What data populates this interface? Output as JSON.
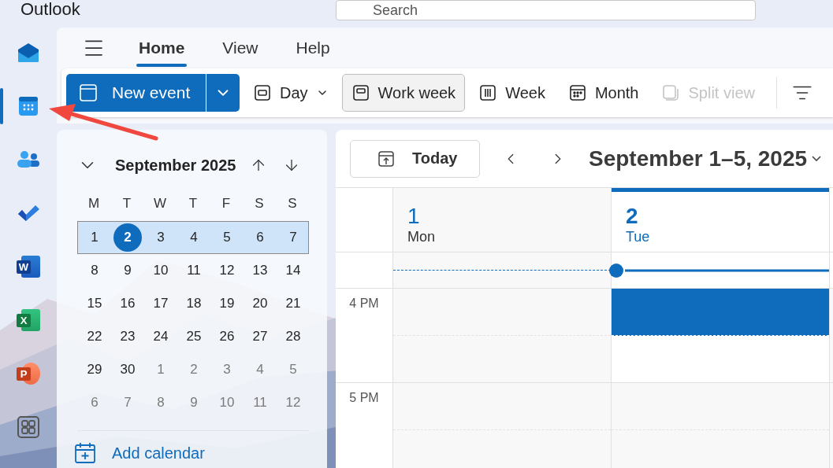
{
  "app_title": "Outlook",
  "search": {
    "placeholder": "Search"
  },
  "rail": [
    {
      "kind": "mail",
      "selected": false
    },
    {
      "kind": "calendar",
      "selected": true
    },
    {
      "kind": "people",
      "selected": false
    },
    {
      "kind": "todo",
      "selected": false
    },
    {
      "kind": "word",
      "letter": "W",
      "selected": false
    },
    {
      "kind": "excel",
      "letter": "X",
      "selected": false
    },
    {
      "kind": "powerpoint",
      "letter": "P",
      "selected": false
    },
    {
      "kind": "apps",
      "selected": false
    }
  ],
  "menu_tabs": [
    {
      "label": "Home",
      "selected": true
    },
    {
      "label": "View",
      "selected": false
    },
    {
      "label": "Help",
      "selected": false
    }
  ],
  "toolbar": {
    "new_event": "New event",
    "views": [
      {
        "kind": "day",
        "label": "Day",
        "selected": false,
        "disabled": false,
        "has_menu": true
      },
      {
        "kind": "workweek",
        "label": "Work week",
        "selected": true,
        "disabled": false,
        "has_menu": false
      },
      {
        "kind": "week",
        "label": "Week",
        "selected": false,
        "disabled": false,
        "has_menu": false
      },
      {
        "kind": "month",
        "label": "Month",
        "selected": false,
        "disabled": false,
        "has_menu": false
      },
      {
        "kind": "split",
        "label": "Split view",
        "selected": false,
        "disabled": true,
        "has_menu": false
      }
    ]
  },
  "mini_calendar": {
    "title": "September 2025",
    "weekdays": [
      "M",
      "T",
      "W",
      "T",
      "F",
      "S",
      "S"
    ],
    "weeks": [
      {
        "selected": true,
        "days": [
          {
            "label": "1",
            "in_month": true,
            "today": false
          },
          {
            "label": "2",
            "in_month": true,
            "today": true
          },
          {
            "label": "3",
            "in_month": true,
            "today": false
          },
          {
            "label": "4",
            "in_month": true,
            "today": false
          },
          {
            "label": "5",
            "in_month": true,
            "today": false
          },
          {
            "label": "6",
            "in_month": true,
            "today": false
          },
          {
            "label": "7",
            "in_month": true,
            "today": false
          }
        ]
      },
      {
        "selected": false,
        "days": [
          {
            "label": "8",
            "in_month": true,
            "today": false
          },
          {
            "label": "9",
            "in_month": true,
            "today": false
          },
          {
            "label": "10",
            "in_month": true,
            "today": false
          },
          {
            "label": "11",
            "in_month": true,
            "today": false
          },
          {
            "label": "12",
            "in_month": true,
            "today": false
          },
          {
            "label": "13",
            "in_month": true,
            "today": false
          },
          {
            "label": "14",
            "in_month": true,
            "today": false
          }
        ]
      },
      {
        "selected": false,
        "days": [
          {
            "label": "15",
            "in_month": true,
            "today": false
          },
          {
            "label": "16",
            "in_month": true,
            "today": false
          },
          {
            "label": "17",
            "in_month": true,
            "today": false
          },
          {
            "label": "18",
            "in_month": true,
            "today": false
          },
          {
            "label": "19",
            "in_month": true,
            "today": false
          },
          {
            "label": "20",
            "in_month": true,
            "today": false
          },
          {
            "label": "21",
            "in_month": true,
            "today": false
          }
        ]
      },
      {
        "selected": false,
        "days": [
          {
            "label": "22",
            "in_month": true,
            "today": false
          },
          {
            "label": "23",
            "in_month": true,
            "today": false
          },
          {
            "label": "24",
            "in_month": true,
            "today": false
          },
          {
            "label": "25",
            "in_month": true,
            "today": false
          },
          {
            "label": "26",
            "in_month": true,
            "today": false
          },
          {
            "label": "27",
            "in_month": true,
            "today": false
          },
          {
            "label": "28",
            "in_month": true,
            "today": false
          }
        ]
      },
      {
        "selected": false,
        "days": [
          {
            "label": "29",
            "in_month": true,
            "today": false
          },
          {
            "label": "30",
            "in_month": true,
            "today": false
          },
          {
            "label": "1",
            "in_month": false,
            "today": false
          },
          {
            "label": "2",
            "in_month": false,
            "today": false
          },
          {
            "label": "3",
            "in_month": false,
            "today": false
          },
          {
            "label": "4",
            "in_month": false,
            "today": false
          },
          {
            "label": "5",
            "in_month": false,
            "today": false
          }
        ]
      },
      {
        "selected": false,
        "days": [
          {
            "label": "6",
            "in_month": false,
            "today": false
          },
          {
            "label": "7",
            "in_month": false,
            "today": false
          },
          {
            "label": "8",
            "in_month": false,
            "today": false
          },
          {
            "label": "9",
            "in_month": false,
            "today": false
          },
          {
            "label": "10",
            "in_month": false,
            "today": false
          },
          {
            "label": "11",
            "in_month": false,
            "today": false
          },
          {
            "label": "12",
            "in_month": false,
            "today": false
          }
        ]
      }
    ],
    "add_calendar": "Add calendar"
  },
  "calendar": {
    "today_button": "Today",
    "range_title": "September 1–5, 2025",
    "days": [
      {
        "number": "1",
        "weekday": "Mon",
        "selected": false,
        "slot_selected": false
      },
      {
        "number": "2",
        "weekday": "Tue",
        "selected": true,
        "slot_selected": true
      }
    ],
    "hours": [
      "4 PM",
      "5 PM"
    ]
  }
}
